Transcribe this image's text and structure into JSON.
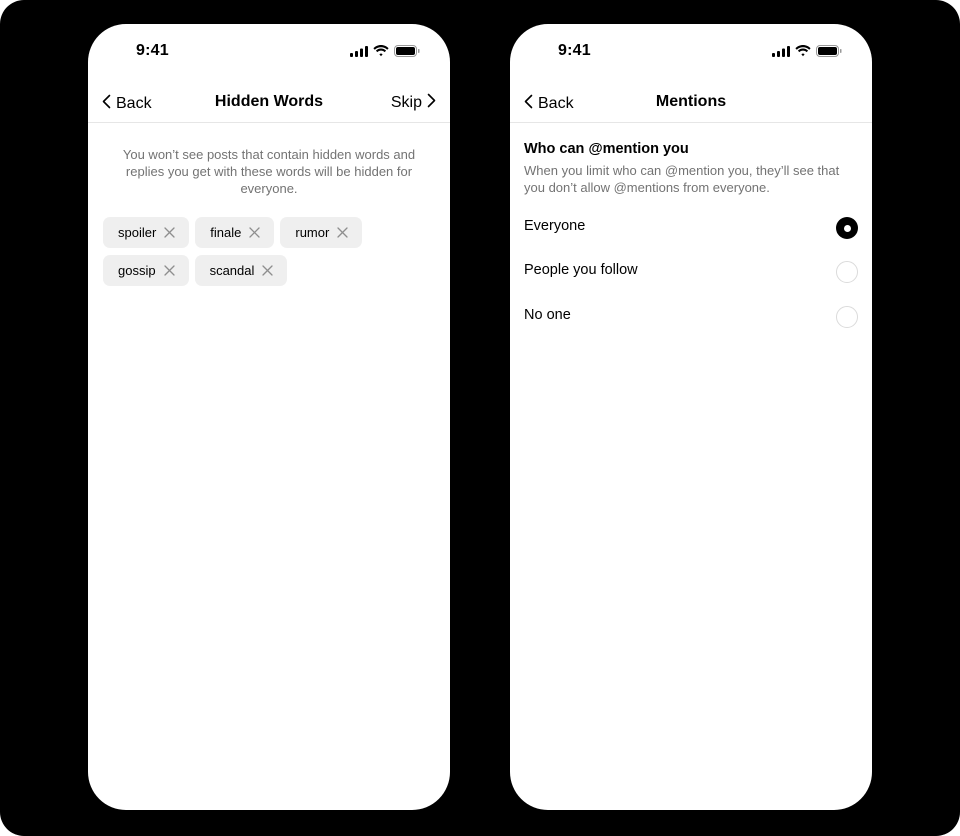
{
  "screens": {
    "hidden_words": {
      "status_time": "9:41",
      "nav": {
        "back_label": "Back",
        "title": "Hidden Words",
        "skip_label": "Skip"
      },
      "hint": "You won’t see posts that contain hidden words and replies you get with these words will be hidden for everyone.",
      "chips": [
        {
          "label": "spoiler"
        },
        {
          "label": "finale"
        },
        {
          "label": "rumor"
        },
        {
          "label": "gossip"
        },
        {
          "label": "scandal"
        }
      ]
    },
    "mentions": {
      "status_time": "9:41",
      "nav": {
        "back_label": "Back",
        "title": "Mentions"
      },
      "section_title": "Who can @mention you",
      "section_desc": "When you limit who can @mention you, they’ll see that you don’t allow @mentions from everyone.",
      "options": [
        {
          "label": "Everyone",
          "selected": true
        },
        {
          "label": "People you follow",
          "selected": false
        },
        {
          "label": "No one",
          "selected": false
        }
      ]
    }
  },
  "icons": {
    "status": [
      "cellular-signal-icon",
      "wifi-icon",
      "battery-icon"
    ],
    "nav": [
      "chevron-left-icon",
      "chevron-right-icon"
    ],
    "chip_remove": "close-icon"
  }
}
